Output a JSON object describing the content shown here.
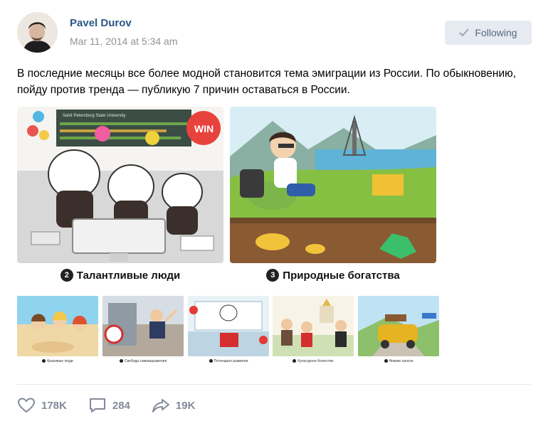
{
  "post": {
    "author": "Pavel Durov",
    "date": "Mar 11, 2014 at 5:34 am",
    "follow_label": "Following",
    "text": "В последние месяцы все более модной становится тема эмиграции из России. По обыкновению, пойду против тренда — публикую 7 причин оставаться в России."
  },
  "images": {
    "big": [
      {
        "num": "2",
        "caption": "Талантливые люди",
        "banner": "Saint Petersburg State University",
        "balloon": "WIN"
      },
      {
        "num": "3",
        "caption": "Природные богатства"
      }
    ],
    "thumbs": [
      {
        "num": "4",
        "caption": "Красивые люди"
      },
      {
        "num": "5",
        "caption": "Свобода самовыражения"
      },
      {
        "num": "6",
        "caption": "Потенциал развития"
      },
      {
        "num": "7",
        "caption": "Культурное богатство"
      },
      {
        "num": "1",
        "caption": "Низкие налоги"
      }
    ]
  },
  "actions": {
    "likes": "178K",
    "comments": "284",
    "shares": "19K"
  },
  "colors": {
    "author": "#2a5885",
    "date": "#939393",
    "follow_bg": "#e5ebf1",
    "action": "#828a99"
  }
}
